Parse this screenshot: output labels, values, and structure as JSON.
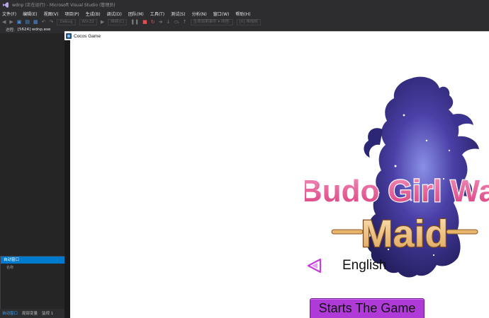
{
  "ide": {
    "window_title": "wdnp (正在运行) - Microsoft Visual Studio (管理员)",
    "menu": [
      "文件(F)",
      "编辑(E)",
      "视图(V)",
      "项目(P)",
      "生成(B)",
      "调试(D)",
      "团队(M)",
      "工具(T)",
      "测试(S)",
      "分析(N)",
      "窗口(W)",
      "帮助(H)"
    ],
    "toolbar": {
      "config": "Debug",
      "platform": "Win32",
      "continue": "继续(C)",
      "debug_location": "生命周期事件 ▾ 线程:",
      "thread": "[0] 堆栈帧"
    },
    "process": {
      "label": "进程:",
      "value": "[5624] wdnp.exe"
    },
    "autos_panel": {
      "title": "自动窗口",
      "column": "名称"
    },
    "bottom_tabs": [
      "自动窗口",
      "局部变量",
      "监视 1"
    ]
  },
  "game": {
    "window_title": "Cocos Game",
    "logo_line1": "Budo Girl War",
    "logo_line2": "Maid",
    "language_label": "English",
    "start_button": "Starts The Game"
  },
  "colors": {
    "ide_background": "#2d2d30",
    "ide_accent": "#007acc",
    "logo_pink": "#e95d9b",
    "logo_gold": "#e8b46a",
    "button_purple": "#b03ad8",
    "arrow_purple": "#c33fd8"
  }
}
